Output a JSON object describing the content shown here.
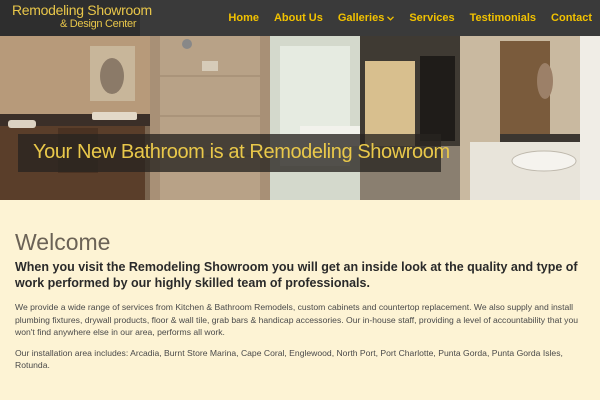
{
  "header": {
    "logo_line1": "Remodeling Showroom",
    "logo_line2": "& Design Center",
    "nav": [
      {
        "label": "Home"
      },
      {
        "label": "About Us"
      },
      {
        "label": "Galleries"
      },
      {
        "label": "Services"
      },
      {
        "label": "Testimonials"
      },
      {
        "label": "Contact"
      }
    ]
  },
  "hero": {
    "tagline": "Your New Bathroom is at Remodeling Showroom"
  },
  "main": {
    "heading": "Welcome",
    "lead": "When you visit the Remodeling Showroom you will get an inside look at the quality and type of work performed by our highly skilled team of professionals.",
    "paragraph1": "We provide a wide range of services from Kitchen & Bathroom Remodels, custom cabinets and countertop replacement. We also supply and install plumbing fixtures, drywall products, floor & wall tile, grab bars & handicap accessories. Our in-house staff, providing a level of accountability that you won't find anywhere else in our area, performs all work.",
    "paragraph2": "Our installation area includes: Arcadia, Burnt Store Marina, Cape Coral, Englewood, North Port, Port Charlotte, Punta Gorda, Punta Gorda Isles, Rotunda."
  },
  "colors": {
    "accent": "#f2c200",
    "header_bg": "#3a3a3a",
    "page_bg": "#fdf3d4"
  }
}
